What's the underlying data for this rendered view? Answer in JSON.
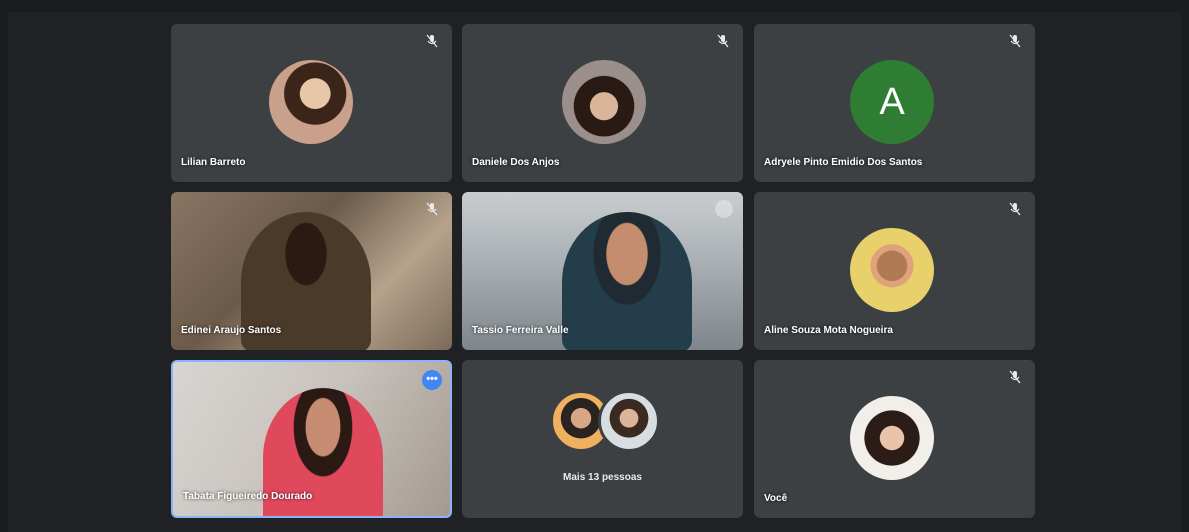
{
  "participants": [
    {
      "name": "Lilian Barreto",
      "avatar": "photo",
      "muted": true
    },
    {
      "name": "Daniele Dos Anjos",
      "avatar": "photo",
      "muted": true
    },
    {
      "name": "Adryele Pinto Emidio Dos Santos",
      "avatar_letter": "A",
      "avatar_color": "#2e7d32",
      "muted": true
    },
    {
      "name": "Edinei Araujo Santos",
      "video": true,
      "muted": true
    },
    {
      "name": "Tassio Ferreira Valle",
      "video": true,
      "muted": false
    },
    {
      "name": "Aline Souza Mota Nogueira",
      "avatar": "photo",
      "muted": true
    },
    {
      "name": "Tabata Figueiredo Dourado",
      "video": true,
      "active_speaker": true
    },
    {
      "more_label": "Mais 13 pessoas"
    },
    {
      "name": "Você",
      "avatar": "photo",
      "muted": true
    }
  ],
  "icons": {
    "mic_off": "mic-off-icon",
    "more": "more-options-icon",
    "pin": "pin-icon"
  },
  "colors": {
    "tile_bg": "#3c4043",
    "page_bg": "#202124",
    "accent": "#4285f4",
    "active_border": "#8ab4f8"
  }
}
